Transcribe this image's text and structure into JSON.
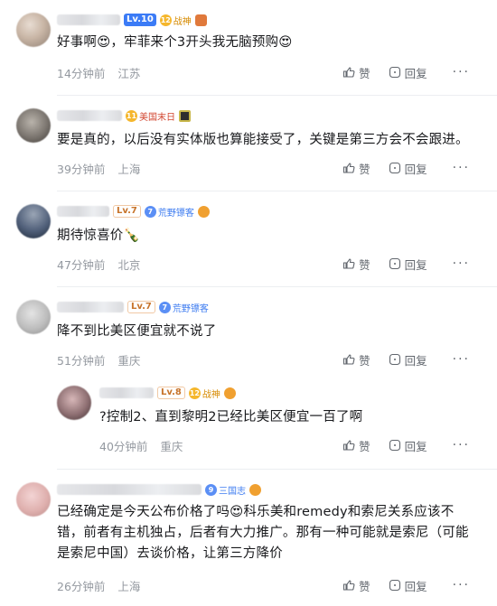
{
  "comments": [
    {
      "level": "Lv.10",
      "badge": "战神",
      "badge_num": "12",
      "text": "好事啊😍，牢菲来个3开头我无脑预购😍",
      "time": "14分钟前",
      "location": "江苏"
    },
    {
      "level": "",
      "badge": "美国末日",
      "badge_num": "11",
      "text": "要是真的，以后没有实体版也算能接受了，关键是第三方会不会跟进。",
      "time": "39分钟前",
      "location": "上海"
    },
    {
      "level": "Lv.7",
      "badge": "荒野镖客",
      "badge_num": "7",
      "text": "期待惊喜价🍾",
      "time": "47分钟前",
      "location": "北京"
    },
    {
      "level": "Lv.7",
      "badge": "荒野镖客",
      "badge_num": "7",
      "text": "降不到比美区便宜就不说了",
      "time": "51分钟前",
      "location": "重庆"
    },
    {
      "level": "Lv.8",
      "badge": "战神",
      "badge_num": "12",
      "text": "?控制2、直到黎明2已经比美区便宜一百了啊",
      "time": "40分钟前",
      "location": "重庆"
    },
    {
      "level": "",
      "badge": "三国志",
      "badge_num": "9",
      "text_line1": "已经确定是今天公布价格了吗😍科乐美和remedy和索尼关系应该不",
      "text_line2": "错，前者有主机独占，后者有大力推广。那有一种可能就是索尼（可能",
      "text_line3": "是索尼中国）去谈价格，让第三方降价",
      "time": "26分钟前",
      "location": "上海"
    }
  ],
  "actions": {
    "like": "赞",
    "reply": "回复",
    "more": "···"
  }
}
